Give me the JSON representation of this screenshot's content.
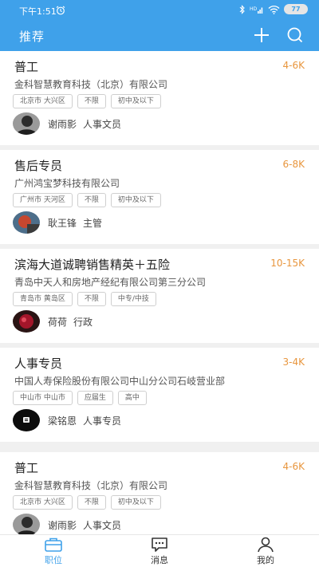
{
  "status": {
    "time": "下午1:51",
    "battery": "77"
  },
  "nav": {
    "title": "推荐"
  },
  "jobs": [
    {
      "title": "普工",
      "salary": "4-6K",
      "company": "金科智慧教育科技（北京）有限公司",
      "tags": [
        "北京市 大兴区",
        "不限",
        "初中及以下"
      ],
      "contact_name": "谢雨影",
      "contact_role": "人事文员"
    },
    {
      "title": "售后专员",
      "salary": "6-8K",
      "company": "广州鸿宝梦科技有限公司",
      "tags": [
        "广州市 天河区",
        "不限",
        "初中及以下"
      ],
      "contact_name": "耿王锋",
      "contact_role": "主管"
    },
    {
      "title": "滨海大道诚聘销售精英＋五险",
      "salary": "10-15K",
      "company": "青岛中天人和房地产经纪有限公司第三分公司",
      "tags": [
        "青岛市 黄岛区",
        "不限",
        "中专/中技"
      ],
      "contact_name": "荷荷",
      "contact_role": "行政"
    },
    {
      "title": "人事专员",
      "salary": "3-4K",
      "company": "中国人寿保险股份有限公司中山分公司石岐营业部",
      "tags": [
        "中山市 中山市",
        "应届生",
        "高中"
      ],
      "contact_name": "梁铭恩",
      "contact_role": "人事专员"
    },
    {
      "title": "普工",
      "salary": "4-6K",
      "company": "金科智慧教育科技（北京）有限公司",
      "tags": [
        "北京市 大兴区",
        "不限",
        "初中及以下"
      ],
      "contact_name": "谢雨影",
      "contact_role": "人事文员"
    }
  ],
  "tabs": [
    {
      "label": "职位",
      "icon": "briefcase-icon"
    },
    {
      "label": "消息",
      "icon": "chat-icon"
    },
    {
      "label": "我的",
      "icon": "user-icon"
    }
  ],
  "colors": {
    "primary": "#3fa1ea",
    "salary": "#e8963e"
  }
}
